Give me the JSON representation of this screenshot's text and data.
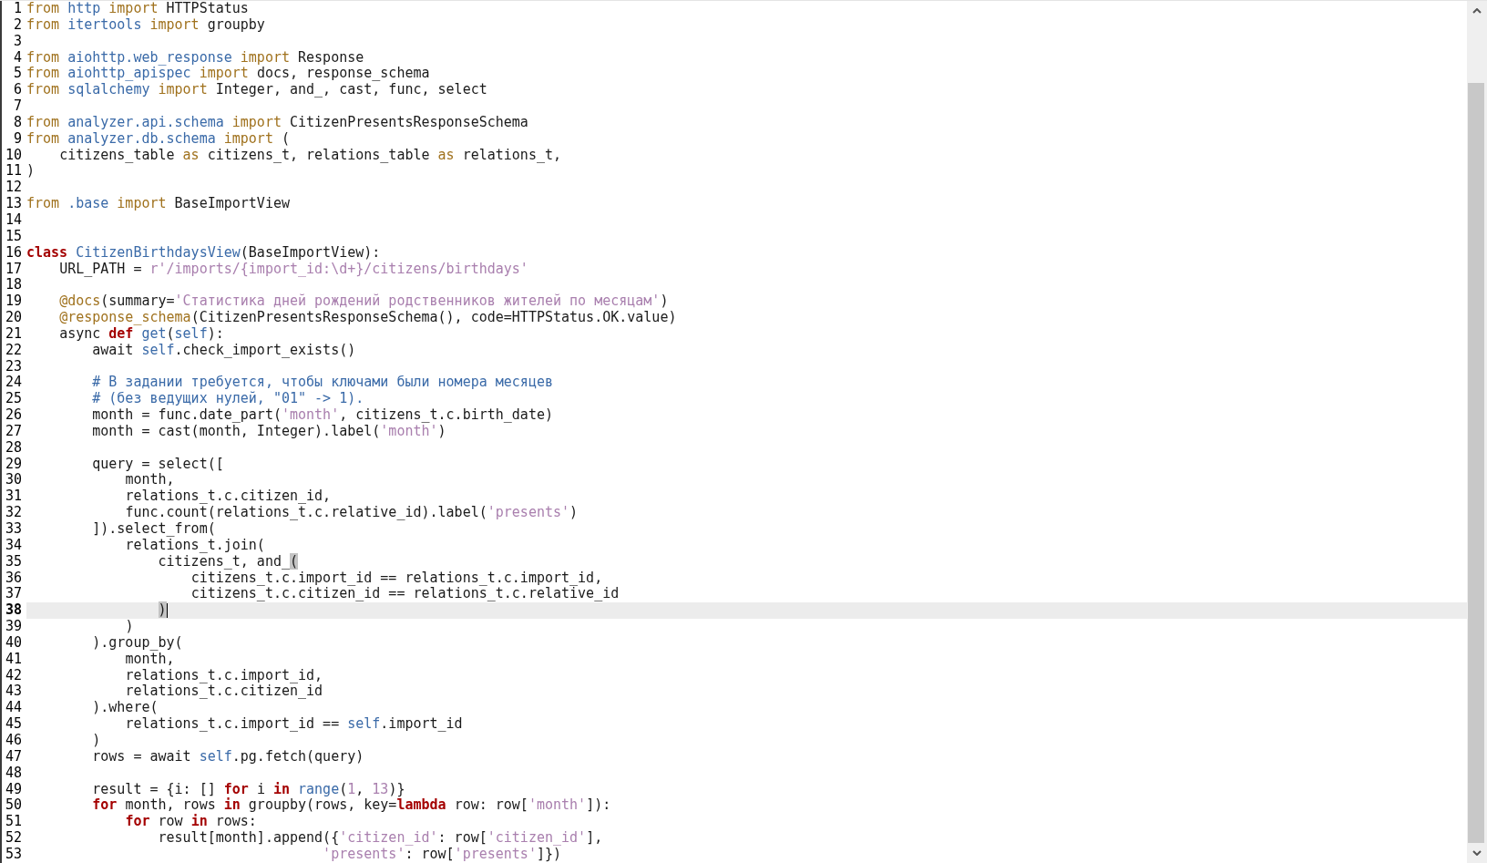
{
  "editor": {
    "lines": [
      {
        "number": "1",
        "current": false,
        "tokens": [
          {
            "text": "from",
            "kind": "import"
          },
          {
            "text": " http",
            "kind": "module"
          },
          {
            "text": " import",
            "kind": "import"
          },
          {
            "text": " HTTPStatus",
            "kind": "text"
          }
        ]
      },
      {
        "number": "2",
        "current": false,
        "tokens": [
          {
            "text": "from",
            "kind": "import"
          },
          {
            "text": " itertools",
            "kind": "module"
          },
          {
            "text": " import",
            "kind": "import"
          },
          {
            "text": " groupby",
            "kind": "text"
          }
        ]
      },
      {
        "number": "3",
        "current": false
      },
      {
        "number": "4",
        "current": false,
        "tokens": [
          {
            "text": "from",
            "kind": "import"
          },
          {
            "text": " aiohttp.web_response",
            "kind": "module"
          },
          {
            "text": " import",
            "kind": "import"
          },
          {
            "text": " Response",
            "kind": "text"
          }
        ]
      },
      {
        "number": "5",
        "current": false,
        "tokens": [
          {
            "text": "from",
            "kind": "import"
          },
          {
            "text": " aiohttp_apispec",
            "kind": "module"
          },
          {
            "text": " import",
            "kind": "import"
          },
          {
            "text": " docs, response_schema",
            "kind": "text"
          }
        ]
      },
      {
        "number": "6",
        "current": false,
        "tokens": [
          {
            "text": "from",
            "kind": "import"
          },
          {
            "text": " sqlalchemy",
            "kind": "module"
          },
          {
            "text": " import",
            "kind": "import"
          },
          {
            "text": " Integer, and_, cast, func, select",
            "kind": "text"
          }
        ]
      },
      {
        "number": "7",
        "current": false
      },
      {
        "number": "8",
        "current": false,
        "tokens": [
          {
            "text": "from",
            "kind": "import"
          },
          {
            "text": " analyzer.api.schema",
            "kind": "module"
          },
          {
            "text": " import",
            "kind": "import"
          },
          {
            "text": " CitizenPresentsResponseSchema",
            "kind": "text"
          }
        ]
      },
      {
        "number": "9",
        "current": false,
        "tokens": [
          {
            "text": "from",
            "kind": "import"
          },
          {
            "text": " analyzer.db.schema",
            "kind": "module"
          },
          {
            "text": " import",
            "kind": "import"
          },
          {
            "text": " (",
            "kind": "text"
          }
        ]
      },
      {
        "number": "10",
        "current": false,
        "tokens": [
          {
            "text": "    citizens_table",
            "kind": "text"
          },
          {
            "text": " as",
            "kind": "import"
          },
          {
            "text": " citizens_t, relations_table",
            "kind": "text"
          },
          {
            "text": " as",
            "kind": "import"
          },
          {
            "text": " relations_t,",
            "kind": "text"
          }
        ]
      },
      {
        "number": "11",
        "current": false,
        "tokens": [
          {
            "text": ")",
            "kind": "text"
          }
        ]
      },
      {
        "number": "12",
        "current": false
      },
      {
        "number": "13",
        "current": false,
        "tokens": [
          {
            "text": "from",
            "kind": "import"
          },
          {
            "text": " .base",
            "kind": "module"
          },
          {
            "text": " import",
            "kind": "import"
          },
          {
            "text": " BaseImportView",
            "kind": "text"
          }
        ]
      },
      {
        "number": "14",
        "current": false
      },
      {
        "number": "15",
        "current": false
      },
      {
        "number": "16",
        "current": false,
        "tokens": [
          {
            "text": "class",
            "kind": "keyword"
          },
          {
            "text": " CitizenBirthdaysView",
            "kind": "name"
          },
          {
            "text": "(BaseImportView):",
            "kind": "text"
          }
        ]
      },
      {
        "number": "17",
        "current": false,
        "tokens": [
          {
            "text": "    URL_PATH = ",
            "kind": "text"
          },
          {
            "text": "r'/imports/{import_id:\\d+}/citizens/birthdays'",
            "kind": "string"
          }
        ]
      },
      {
        "number": "18",
        "current": false
      },
      {
        "number": "19",
        "current": false,
        "tokens": [
          {
            "text": "    @docs",
            "kind": "decorator"
          },
          {
            "text": "(summary=",
            "kind": "text"
          },
          {
            "text": "'Статистика дней рождений родственников жителей по месяцам'",
            "kind": "string"
          },
          {
            "text": ")",
            "kind": "text"
          }
        ]
      },
      {
        "number": "20",
        "current": false,
        "tokens": [
          {
            "text": "    @response_schema",
            "kind": "decorator"
          },
          {
            "text": "(CitizenPresentsResponseSchema(), code=HTTPStatus.OK.value)",
            "kind": "text"
          }
        ]
      },
      {
        "number": "21",
        "current": false,
        "tokens": [
          {
            "text": "    async ",
            "kind": "text"
          },
          {
            "text": "def",
            "kind": "keyword"
          },
          {
            "text": " get",
            "kind": "name"
          },
          {
            "text": "(",
            "kind": "text"
          },
          {
            "text": "self",
            "kind": "name"
          },
          {
            "text": "):",
            "kind": "text"
          }
        ]
      },
      {
        "number": "22",
        "current": false,
        "tokens": [
          {
            "text": "        await ",
            "kind": "text"
          },
          {
            "text": "self",
            "kind": "name"
          },
          {
            "text": ".check_import_exists()",
            "kind": "text"
          }
        ]
      },
      {
        "number": "23",
        "current": false
      },
      {
        "number": "24",
        "current": false,
        "tokens": [
          {
            "text": "        # В задании требуется, чтобы ключами были номера месяцев",
            "kind": "comment"
          }
        ]
      },
      {
        "number": "25",
        "current": false,
        "tokens": [
          {
            "text": "        # (без ведущих нулей, \"01\" -> 1).",
            "kind": "comment"
          }
        ]
      },
      {
        "number": "26",
        "current": false,
        "tokens": [
          {
            "text": "        month = func.date_part(",
            "kind": "text"
          },
          {
            "text": "'month'",
            "kind": "string"
          },
          {
            "text": ", citizens_t.c.birth_date)",
            "kind": "text"
          }
        ]
      },
      {
        "number": "27",
        "current": false,
        "tokens": [
          {
            "text": "        month = cast(month, Integer).label(",
            "kind": "text"
          },
          {
            "text": "'month'",
            "kind": "string"
          },
          {
            "text": ")",
            "kind": "text"
          }
        ]
      },
      {
        "number": "28",
        "current": false
      },
      {
        "number": "29",
        "current": false,
        "tokens": [
          {
            "text": "        query = select([",
            "kind": "text"
          }
        ]
      },
      {
        "number": "30",
        "current": false,
        "tokens": [
          {
            "text": "            month,",
            "kind": "text"
          }
        ]
      },
      {
        "number": "31",
        "current": false,
        "tokens": [
          {
            "text": "            relations_t.c.citizen_id,",
            "kind": "text"
          }
        ]
      },
      {
        "number": "32",
        "current": false,
        "tokens": [
          {
            "text": "            func.count(relations_t.c.relative_id).label(",
            "kind": "text"
          },
          {
            "text": "'presents'",
            "kind": "string"
          },
          {
            "text": ")",
            "kind": "text"
          }
        ]
      },
      {
        "number": "33",
        "current": false,
        "tokens": [
          {
            "text": "        ]).select_from(",
            "kind": "text"
          }
        ]
      },
      {
        "number": "34",
        "current": false,
        "tokens": [
          {
            "text": "            relations_t.join(",
            "kind": "text"
          }
        ]
      },
      {
        "number": "35",
        "current": false,
        "tokens": [
          {
            "text": "                citizens_t, and_",
            "kind": "text"
          },
          {
            "text": "(",
            "kind": "match"
          }
        ]
      },
      {
        "number": "36",
        "current": false,
        "tokens": [
          {
            "text": "                    citizens_t.c.import_id == relations_t.c.import_id,",
            "kind": "text"
          }
        ]
      },
      {
        "number": "37",
        "current": false,
        "tokens": [
          {
            "text": "                    citizens_t.c.citizen_id == relations_t.c.relative_id",
            "kind": "text"
          }
        ]
      },
      {
        "number": "38",
        "current": true,
        "tokens": [
          {
            "text": "                )",
            "kind": "match"
          }
        ]
      },
      {
        "number": "39",
        "current": false,
        "tokens": [
          {
            "text": "            )",
            "kind": "text"
          }
        ]
      },
      {
        "number": "40",
        "current": false,
        "tokens": [
          {
            "text": "        ).group_by(",
            "kind": "text"
          }
        ]
      },
      {
        "number": "41",
        "current": false,
        "tokens": [
          {
            "text": "            month,",
            "kind": "text"
          }
        ]
      },
      {
        "number": "42",
        "current": false,
        "tokens": [
          {
            "text": "            relations_t.c.import_id,",
            "kind": "text"
          }
        ]
      },
      {
        "number": "43",
        "current": false,
        "tokens": [
          {
            "text": "            relations_t.c.citizen_id",
            "kind": "text"
          }
        ]
      },
      {
        "number": "44",
        "current": false,
        "tokens": [
          {
            "text": "        ).where(",
            "kind": "text"
          }
        ]
      },
      {
        "number": "45",
        "current": false,
        "tokens": [
          {
            "text": "            relations_t.c.import_id == ",
            "kind": "text"
          },
          {
            "text": "self",
            "kind": "name"
          },
          {
            "text": ".import_id",
            "kind": "text"
          }
        ]
      },
      {
        "number": "46",
        "current": false,
        "tokens": [
          {
            "text": "        )",
            "kind": "text"
          }
        ]
      },
      {
        "number": "47",
        "current": false,
        "tokens": [
          {
            "text": "        rows = await ",
            "kind": "text"
          },
          {
            "text": "self",
            "kind": "name"
          },
          {
            "text": ".pg.fetch(query)",
            "kind": "text"
          }
        ]
      },
      {
        "number": "48",
        "current": false
      },
      {
        "number": "49",
        "current": false,
        "tokens": [
          {
            "text": "        result = {i: [] ",
            "kind": "text"
          },
          {
            "text": "for",
            "kind": "keyword"
          },
          {
            "text": " i ",
            "kind": "text"
          },
          {
            "text": "in",
            "kind": "keyword"
          },
          {
            "text": " range",
            "kind": "name"
          },
          {
            "text": "(",
            "kind": "text"
          },
          {
            "text": "1",
            "kind": "number"
          },
          {
            "text": ", ",
            "kind": "text"
          },
          {
            "text": "13",
            "kind": "number"
          },
          {
            "text": ")}",
            "kind": "text"
          }
        ]
      },
      {
        "number": "50",
        "current": false,
        "tokens": [
          {
            "text": "        for",
            "kind": "keyword"
          },
          {
            "text": " month, rows ",
            "kind": "text"
          },
          {
            "text": "in",
            "kind": "keyword"
          },
          {
            "text": " groupby(rows, key=",
            "kind": "text"
          },
          {
            "text": "lambda",
            "kind": "keyword"
          },
          {
            "text": " row: row[",
            "kind": "text"
          },
          {
            "text": "'month'",
            "kind": "string"
          },
          {
            "text": "]):",
            "kind": "text"
          }
        ]
      },
      {
        "number": "51",
        "current": false,
        "tokens": [
          {
            "text": "            for",
            "kind": "keyword"
          },
          {
            "text": " row ",
            "kind": "text"
          },
          {
            "text": "in",
            "kind": "keyword"
          },
          {
            "text": " rows:",
            "kind": "text"
          }
        ]
      },
      {
        "number": "52",
        "current": false,
        "tokens": [
          {
            "text": "                result[month].append({",
            "kind": "text"
          },
          {
            "text": "'citizen_id'",
            "kind": "string"
          },
          {
            "text": ": row[",
            "kind": "text"
          },
          {
            "text": "'citizen_id'",
            "kind": "string"
          },
          {
            "text": "],",
            "kind": "text"
          }
        ]
      },
      {
        "number": "53",
        "current": false,
        "tokens": [
          {
            "text": "                                    'presents'",
            "kind": "string"
          },
          {
            "text": ": row[",
            "kind": "text"
          },
          {
            "text": "'presents'",
            "kind": "string"
          },
          {
            "text": "]})",
            "kind": "text"
          }
        ]
      }
    ]
  }
}
